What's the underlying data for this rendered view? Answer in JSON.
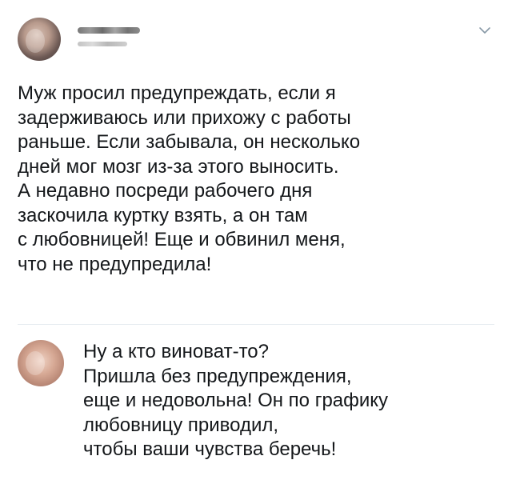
{
  "post": {
    "author": {
      "avatar_icon": "user-avatar-icon",
      "name_state": "blurred",
      "handle_state": "blurred"
    },
    "menu_icon": "chevron-down-icon",
    "text_lines": [
      "Муж просил предупреждать, если я",
      "задерживаюсь или прихожу с работы",
      "раньше. Если забывала, он несколько",
      "дней мог мозг из-за этого выносить.",
      "А недавно посреди рабочего дня",
      "заскочила куртку взять, а он там",
      "с любовницей! Еще и обвинил меня,",
      "что не предупредила!"
    ]
  },
  "reply": {
    "author": {
      "avatar_icon": "user-avatar-icon"
    },
    "text_lines": [
      "Ну а кто виноват-то?",
      "Пришла без предупреждения,",
      "еще и недовольна! Он по графику",
      "любовницу приводил,",
      "чтобы ваши чувства беречь!"
    ]
  },
  "colors": {
    "text": "#14171a",
    "divider": "#e6ecf0",
    "chevron": "#8899a6",
    "background": "#ffffff"
  }
}
